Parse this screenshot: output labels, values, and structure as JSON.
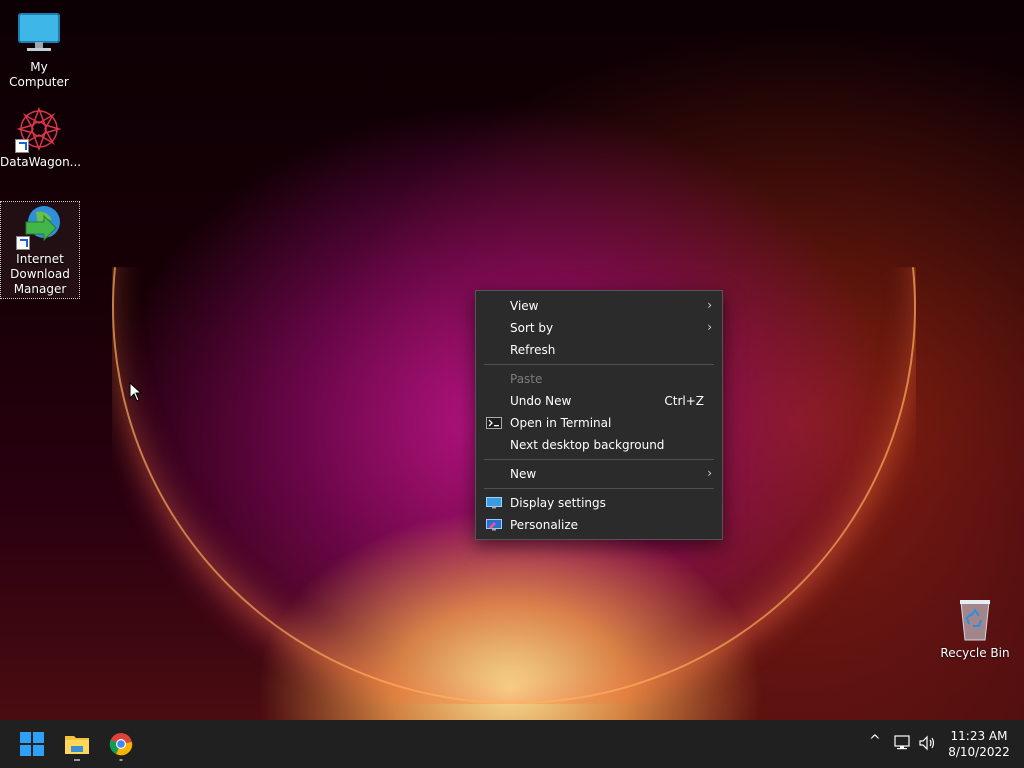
{
  "desktop": {
    "icons": [
      {
        "label": "My Computer"
      },
      {
        "label": "DataWagon..."
      },
      {
        "label": "Internet\nDownload\nManager"
      },
      {
        "label": "Recycle Bin"
      }
    ]
  },
  "context_menu": {
    "items": [
      {
        "label": "View",
        "submenu": true
      },
      {
        "label": "Sort by",
        "submenu": true
      },
      {
        "label": "Refresh"
      },
      {
        "label": "Paste",
        "disabled": true
      },
      {
        "label": "Undo New",
        "shortcut": "Ctrl+Z"
      },
      {
        "label": "Open in Terminal",
        "icon": "terminal-icon"
      },
      {
        "label": "Next desktop background"
      },
      {
        "label": "New",
        "submenu": true
      },
      {
        "label": "Display settings",
        "icon": "display-settings-icon"
      },
      {
        "label": "Personalize",
        "icon": "personalize-icon"
      }
    ]
  },
  "taskbar": {
    "apps": [
      {
        "name": "start-button",
        "icon": "windows-logo-icon"
      },
      {
        "name": "file-explorer",
        "icon": "folder-icon"
      },
      {
        "name": "chrome",
        "icon": "chrome-icon"
      }
    ],
    "tray": {
      "chevron": "^",
      "time": "11:23 AM",
      "date": "8/10/2022"
    }
  },
  "colors": {
    "menu_bg": "#2b2b2b",
    "taskbar_bg": "#202020",
    "accent": "#0078d4"
  }
}
